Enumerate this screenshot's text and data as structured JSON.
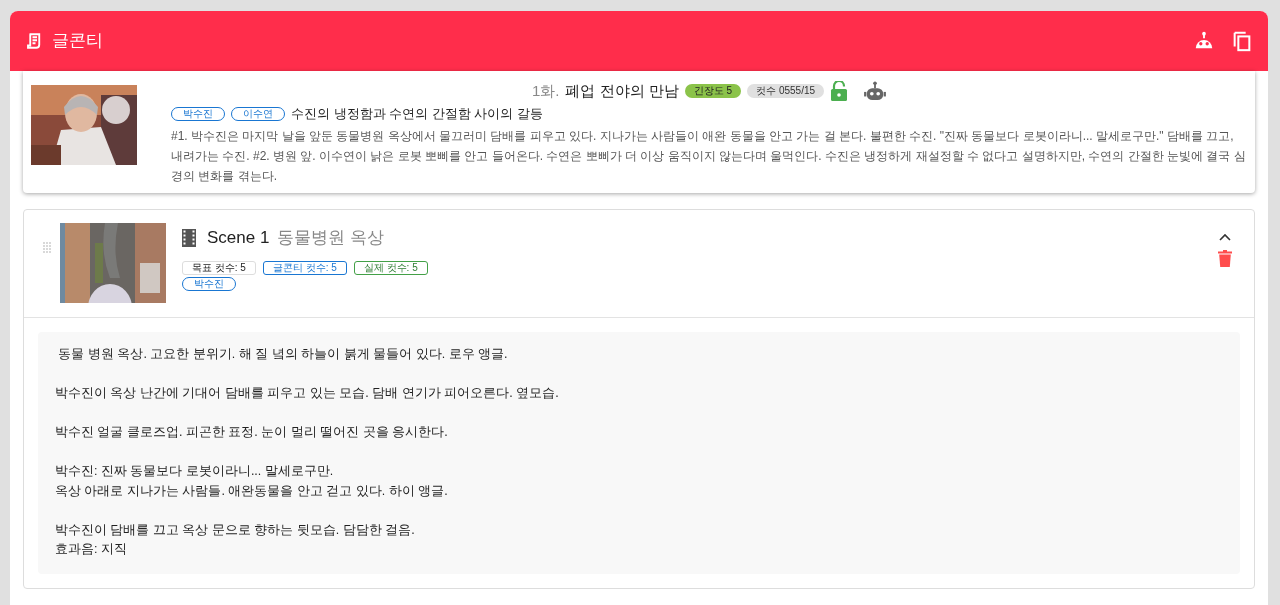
{
  "app_bar": {
    "title": "글콘티"
  },
  "episode": {
    "number": "1화.",
    "title": "폐업 전야의 만남",
    "tension": "긴장도 5",
    "cuts": "컷수 0555/15",
    "locked": false,
    "characters": [
      "박수진",
      "이수연"
    ],
    "logline": "수진의 냉정함과 수연의 간절함 사이의 갈등",
    "summary": "#1. 박수진은 마지막 날을 앞둔 동물병원 옥상에서 물끄러미 담배를 피우고 있다. 지나가는 사람들이 애완 동물을 안고 가는 걸 본다. 불편한 수진. \"진짜 동물보다 로봇이라니... 말세로구만.\" 담배를 끄고, 내려가는 수진. #2. 병원 앞. 이수연이 낡은 로봇 뽀삐를 안고 들어온다. 수연은 뽀삐가 더 이상 움직이지 않는다며 울먹인다. 수진은 냉정하게 재설정할 수 없다고 설명하지만, 수연의 간절한 눈빛에 결국 심경의 변화를 겪는다."
  },
  "scene": {
    "title": "Scene 1",
    "location": "동물병원 옥상",
    "expanded": true,
    "counts": [
      {
        "kind": "target",
        "label": "목표 컷수: 5"
      },
      {
        "kind": "conti",
        "label": "글콘티 컷수: 5"
      },
      {
        "kind": "actual",
        "label": "실제 컷수: 5"
      }
    ],
    "characters": [
      "박수진"
    ],
    "script": " 동물 병원 옥상. 고요한 분위기. 해 질 녘의 하늘이 붉게 물들어 있다. 로우 앵글.\n\n박수진이 옥상 난간에 기대어 담배를 피우고 있는 모습. 담배 연기가 피어오른다. 옆모습.\n\n박수진 얼굴 클로즈업. 피곤한 표정. 눈이 멀리 떨어진 곳을 응시한다.\n\n박수진: 진짜 동물보다 로봇이라니... 말세로구만.\n옥상 아래로 지나가는 사람들. 애완동물을 안고 걷고 있다. 하이 앵글.\n\n박수진이 담배를 끄고 옥상 문으로 향하는 뒷모습. 담담한 걸음.\n효과음: 지직"
  }
}
